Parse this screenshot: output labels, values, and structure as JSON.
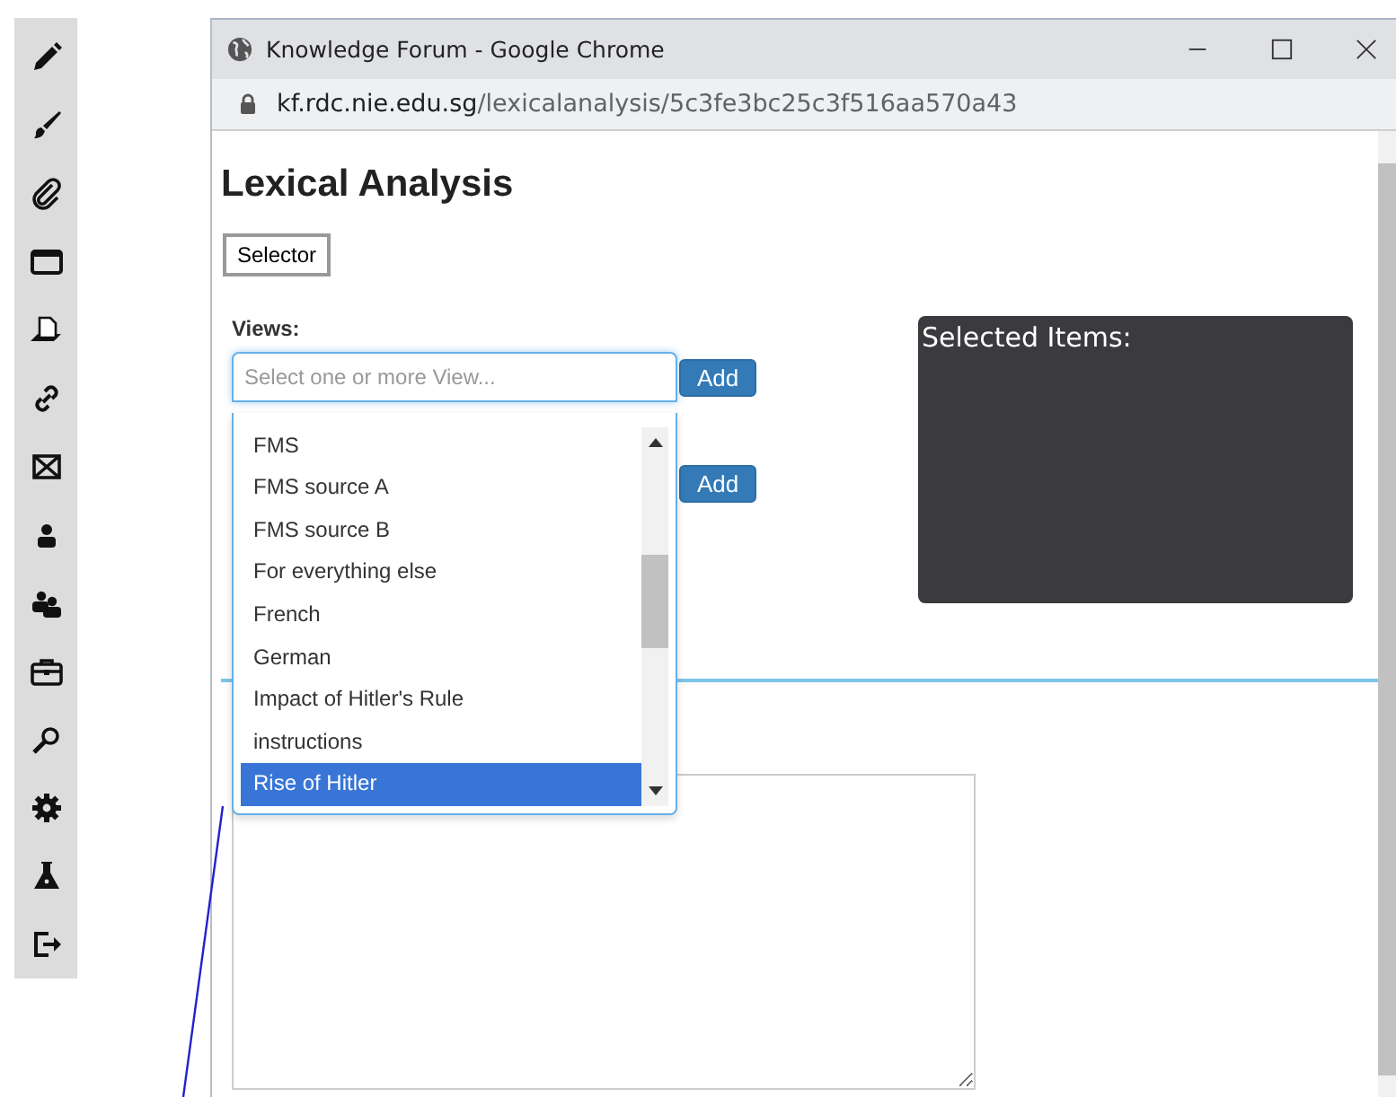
{
  "window": {
    "title": "Knowledge Forum - Google Chrome",
    "url_host": "kf.rdc.nie.edu.sg",
    "url_path": "/lexicalanalysis/5c3fe3bc25c3f516aa570a43"
  },
  "page": {
    "heading": "Lexical Analysis",
    "selector_button": "Selector",
    "views_label": "Views:",
    "views_field": {
      "placeholder": "Select one or more View..."
    },
    "add_buttons": [
      "Add",
      "Add"
    ],
    "dropdown": {
      "options": [
        {
          "label": "FMS",
          "selected": false
        },
        {
          "label": "FMS source A",
          "selected": false
        },
        {
          "label": "FMS source B",
          "selected": false
        },
        {
          "label": "For everything else",
          "selected": false
        },
        {
          "label": "French",
          "selected": false
        },
        {
          "label": "German",
          "selected": false
        },
        {
          "label": "Impact of Hitler's Rule",
          "selected": false
        },
        {
          "label": "instructions",
          "selected": false
        },
        {
          "label": "Rise of Hitler",
          "selected": true
        }
      ]
    },
    "selected_panel": {
      "title": "Selected Items:"
    }
  }
}
